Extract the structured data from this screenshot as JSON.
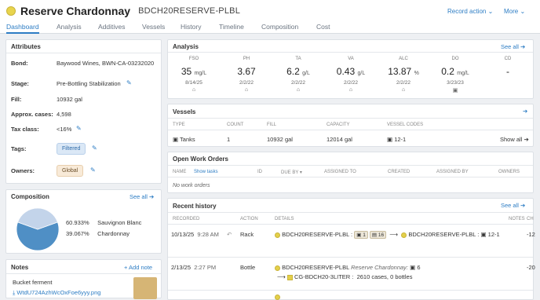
{
  "header": {
    "title": "Reserve Chardonnay",
    "code": "BDCH20RESERVE-PLBL",
    "record_action": "Record action",
    "more": "More"
  },
  "tabs": [
    "Dashboard",
    "Analysis",
    "Additives",
    "Vessels",
    "History",
    "Timeline",
    "Composition",
    "Cost"
  ],
  "attributes": {
    "title": "Attributes",
    "bond_label": "Bond:",
    "bond": "Baywood Wines, BWN-CA-03232020",
    "stage_label": "Stage:",
    "stage": "Pre-Bottling Stabilization",
    "fill_label": "Fill:",
    "fill": "10932 gal",
    "cases_label": "Approx. cases:",
    "cases": "4,598",
    "tax_label": "Tax class:",
    "tax": "<16%",
    "tags_label": "Tags:",
    "tag": "Filtered",
    "owners_label": "Owners:",
    "owner": "Global"
  },
  "composition": {
    "title": "Composition",
    "see_all": "See all",
    "items": [
      {
        "pct": "60.933%",
        "name": "Sauvignon Blanc",
        "value": 60.933,
        "color": "#4f8fc5"
      },
      {
        "pct": "39.067%",
        "name": "Chardonnay",
        "value": 39.067,
        "color": "#c3d4ea"
      }
    ]
  },
  "notes": {
    "title": "Notes",
    "add": "+ Add note",
    "item": "Bucket ferment",
    "file": "WtdU724AzhWcOxFoe6yyy.png"
  },
  "analysis": {
    "title": "Analysis",
    "see_all": "See all",
    "metrics": [
      {
        "label": "FSO",
        "value": "35",
        "unit": "mg/L",
        "date": "8/14/25",
        "icon": "⌂"
      },
      {
        "label": "PH",
        "value": "3.67",
        "unit": "",
        "date": "2/2/22",
        "icon": "⌂"
      },
      {
        "label": "TA",
        "value": "6.2",
        "unit": "g/L",
        "date": "2/2/22",
        "icon": "⌂"
      },
      {
        "label": "VA",
        "value": "0.43",
        "unit": "g/L",
        "date": "2/2/22",
        "icon": "⌂"
      },
      {
        "label": "ALC",
        "value": "13.87",
        "unit": "%",
        "date": "2/2/22",
        "icon": "⌂"
      },
      {
        "label": "DO",
        "value": "0.2",
        "unit": "mg/L",
        "date": "3/23/23",
        "icon": "▣"
      },
      {
        "label": "CD",
        "value": "-",
        "unit": "",
        "date": "",
        "icon": ""
      }
    ]
  },
  "vessels": {
    "title": "Vessels",
    "headers": {
      "type": "TYPE",
      "count": "COUNT",
      "fill": "FILL",
      "capacity": "CAPACITY",
      "codes": "VESSEL CODES"
    },
    "row": {
      "type": "Tanks",
      "count": "1",
      "fill": "10932 gal",
      "capacity": "12014 gal",
      "codes": "12-1",
      "show_all": "Show all"
    }
  },
  "work_orders": {
    "title": "Open Work Orders",
    "headers": {
      "name": "NAME",
      "show_tasks": "Show tasks",
      "id": "ID",
      "due": "DUE BY",
      "assigned_to": "ASSIGNED TO",
      "created": "CREATED",
      "assigned_by": "ASSIGNED BY",
      "owners": "OWNERS"
    },
    "empty": "No work orders"
  },
  "history": {
    "title": "Recent history",
    "see_all": "See all",
    "headers": {
      "recorded": "RECORDED",
      "action": "ACTION",
      "details": "DETAILS",
      "notes": "NOTES",
      "ch": "CH"
    },
    "rows": [
      {
        "date": "10/13/25",
        "time": "9:28 AM",
        "action": "Rack",
        "lot": "BDCH20RESERVE-PLBL",
        "b1": "1",
        "b2": "16",
        "arrow": "⟶",
        "lot2": "BDCH20RESERVE-PLBL",
        "vessel": "12-1",
        "change": "-12"
      },
      {
        "date": "2/13/25",
        "time": "2:27 PM",
        "action": "Bottle",
        "lot": "BDCH20RESERVE-PLBL",
        "lot_note": "Reserve Chardonnay:",
        "count": "6",
        "arrow": "⟶",
        "sku": "CG-BDCH20-3LITER",
        "qty": "2610 cases, 0 bottles",
        "change": "-20"
      }
    ]
  }
}
